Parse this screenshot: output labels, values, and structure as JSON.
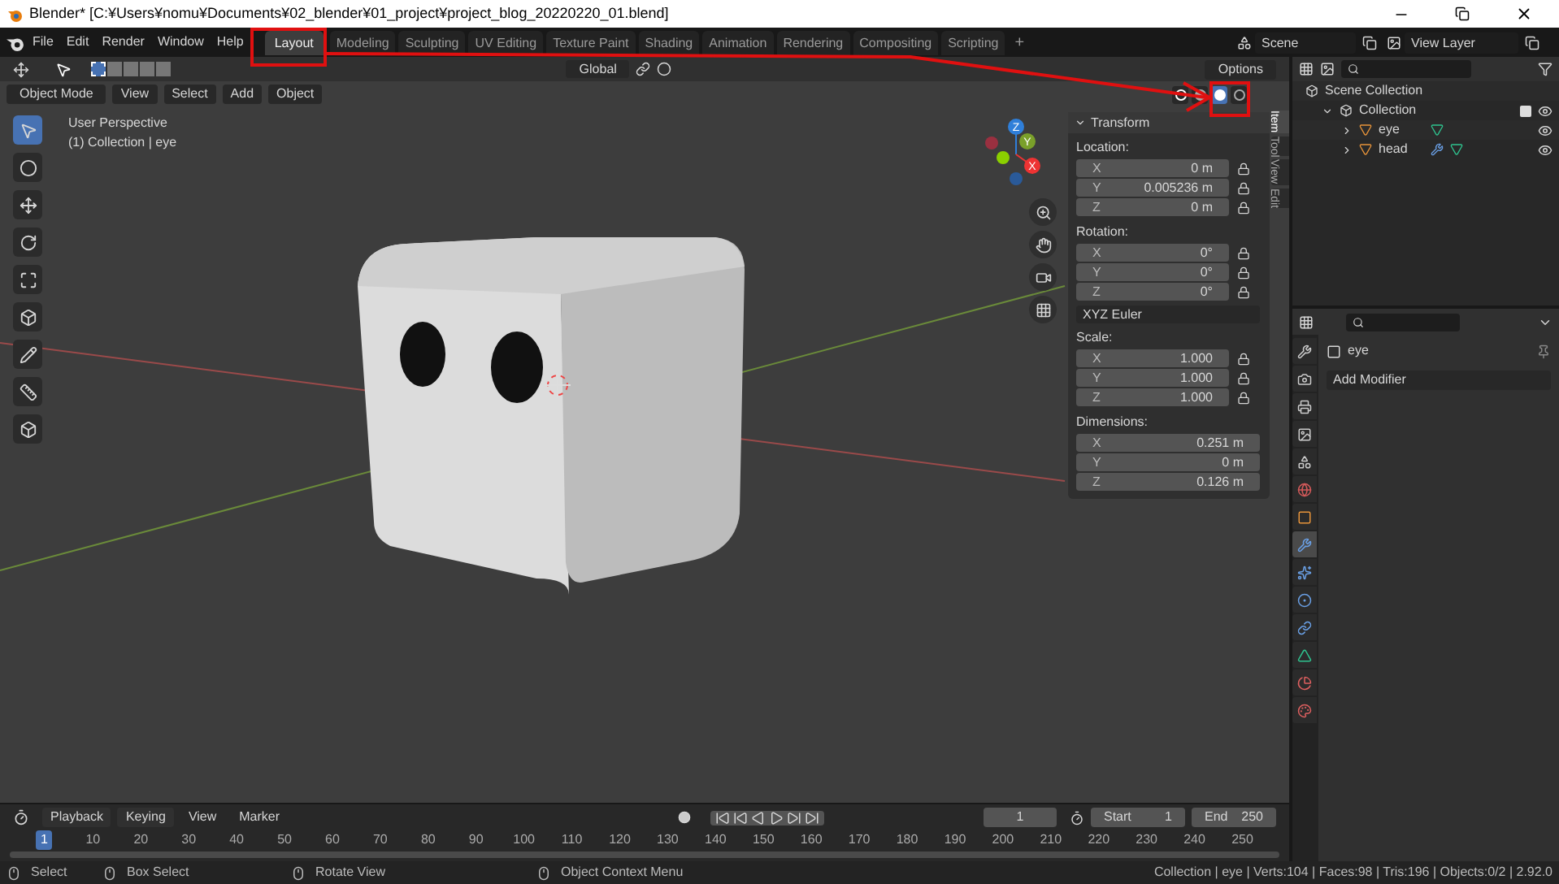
{
  "window": {
    "title": "Blender* [C:¥Users¥nomu¥Documents¥02_blender¥01_project¥project_blog_20220220_01.blend]"
  },
  "menu": [
    "File",
    "Edit",
    "Render",
    "Window",
    "Help"
  ],
  "workspaces": [
    {
      "label": "Layout",
      "selected": true
    },
    {
      "label": "Modeling",
      "selected": false
    },
    {
      "label": "Sculpting",
      "selected": false
    },
    {
      "label": "UV Editing",
      "selected": false
    },
    {
      "label": "Texture Paint",
      "selected": false
    },
    {
      "label": "Shading",
      "selected": false
    },
    {
      "label": "Animation",
      "selected": false
    },
    {
      "label": "Rendering",
      "selected": false
    },
    {
      "label": "Compositing",
      "selected": false
    },
    {
      "label": "Scripting",
      "selected": false
    }
  ],
  "add_workspace": "+",
  "scene": "Scene",
  "view_layer": "View Layer",
  "tool_header": {
    "orientation": "Global",
    "options": "Options"
  },
  "viewport_header": {
    "mode": "Object Mode",
    "menus": [
      "View",
      "Select",
      "Add",
      "Object"
    ],
    "shading": [
      {
        "selected": false
      },
      {
        "selected": false
      },
      {
        "selected": true
      },
      {
        "selected": false
      }
    ]
  },
  "viewport": {
    "view_name": "User Perspective",
    "object_info": "(1) Collection | eye",
    "gizmo": [
      "X",
      "Y",
      "Z"
    ]
  },
  "sidebar_tabs": [
    {
      "label": "Item",
      "selected": true
    },
    {
      "label": "Tool",
      "selected": false
    },
    {
      "label": "View",
      "selected": false
    },
    {
      "label": "Edit",
      "selected": false
    }
  ],
  "transform": {
    "title": "Transform",
    "groups": [
      {
        "label": "Location:",
        "locks": true,
        "rows": [
          {
            "axis": "X",
            "value": "0 m"
          },
          {
            "axis": "Y",
            "value": "0.005236 m"
          },
          {
            "axis": "Z",
            "value": "0 m"
          }
        ]
      },
      {
        "label": "Rotation:",
        "locks": true,
        "rows": [
          {
            "axis": "X",
            "value": "0°"
          },
          {
            "axis": "Y",
            "value": "0°"
          },
          {
            "axis": "Z",
            "value": "0°"
          }
        ],
        "mode": "XYZ Euler"
      },
      {
        "label": "Scale:",
        "locks": true,
        "rows": [
          {
            "axis": "X",
            "value": "1.000"
          },
          {
            "axis": "Y",
            "value": "1.000"
          },
          {
            "axis": "Z",
            "value": "1.000"
          }
        ]
      },
      {
        "label": "Dimensions:",
        "locks": false,
        "rows": [
          {
            "axis": "X",
            "value": "0.251 m"
          },
          {
            "axis": "Y",
            "value": "0 m"
          },
          {
            "axis": "Z",
            "value": "0.126 m"
          }
        ]
      }
    ]
  },
  "outliner": {
    "root": "Scene Collection",
    "items": [
      {
        "label": "Collection",
        "checked": true,
        "children": [
          {
            "label": "eye",
            "modifier": false
          },
          {
            "label": "head",
            "modifier": true
          }
        ]
      }
    ]
  },
  "properties": {
    "object": "eye",
    "add_modifier": "Add Modifier",
    "tabs": [
      {
        "kind": "tool",
        "selected": false
      },
      {
        "kind": "render",
        "selected": false
      },
      {
        "kind": "output",
        "selected": false
      },
      {
        "kind": "view_layer",
        "selected": false
      },
      {
        "kind": "scene",
        "selected": false
      },
      {
        "kind": "world",
        "selected": false
      },
      {
        "kind": "object",
        "selected": false
      },
      {
        "kind": "modifier",
        "selected": true
      },
      {
        "kind": "particles",
        "selected": false
      },
      {
        "kind": "physics",
        "selected": false
      },
      {
        "kind": "constraints",
        "selected": false
      },
      {
        "kind": "data",
        "selected": false
      },
      {
        "kind": "material",
        "selected": false
      },
      {
        "kind": "texture",
        "selected": false
      }
    ]
  },
  "timeline": {
    "menus": [
      "Playback",
      "Keying",
      "View",
      "Marker"
    ],
    "current_frame": "1",
    "start_label": "Start",
    "start": "1",
    "end_label": "End",
    "end": "250",
    "playhead": "1",
    "ticks": [
      "10",
      "20",
      "30",
      "40",
      "50",
      "60",
      "70",
      "80",
      "90",
      "100",
      "110",
      "120",
      "130",
      "140",
      "150",
      "160",
      "170",
      "180",
      "190",
      "200",
      "210",
      "220",
      "230",
      "240",
      "250"
    ]
  },
  "status_bar": {
    "hints": [
      "Select",
      "Box Select",
      "Rotate View",
      "Object Context Menu"
    ],
    "stats": "Collection | eye | Verts:104 | Faces:98 | Tris:196 | Objects:0/2 | 2.92.0"
  }
}
